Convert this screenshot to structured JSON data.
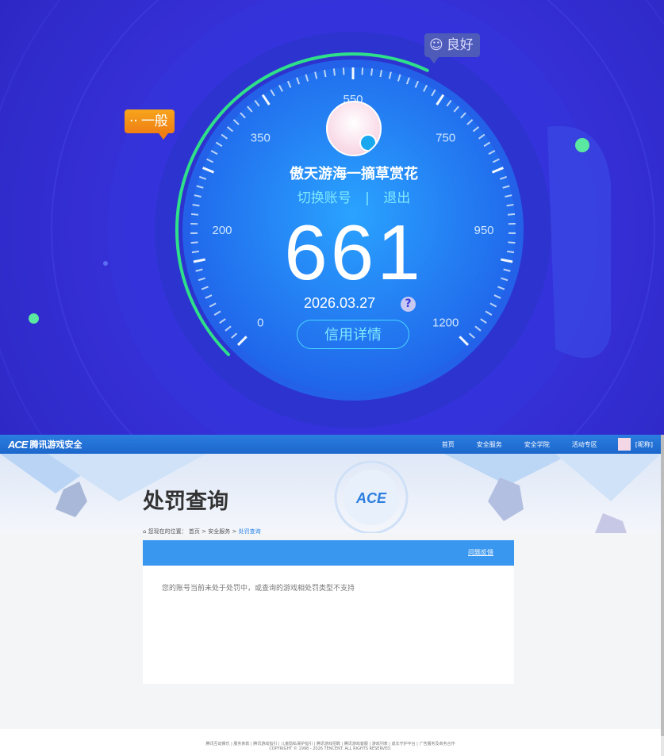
{
  "credit": {
    "bubble_normal": "一般",
    "bubble_good": "良好",
    "nickname": "傲天游海一摘草赏花",
    "switch_label": "切换账号",
    "separator": "|",
    "logout_label": "退出",
    "score": "661",
    "date": "2026.03.27",
    "help_glyph": "?",
    "detail_label": "信用详情",
    "ticks": [
      {
        "label": "0",
        "value": 0
      },
      {
        "label": "200",
        "value": 200
      },
      {
        "label": "350",
        "value": 350
      },
      {
        "label": "550",
        "value": 550
      },
      {
        "label": "750",
        "value": 750
      },
      {
        "label": "950",
        "value": 950
      },
      {
        "label": "1200",
        "value": 1200
      }
    ],
    "gauge_level": 661,
    "gauge_max": 1200,
    "colors": {
      "accent": "#49d6ff",
      "track": "#2fe08a",
      "orange": "#f29218"
    }
  },
  "site": {
    "logo_mark": "ACE",
    "logo_text": "腾讯游戏安全",
    "nav": [
      "首页",
      "安全服务",
      "安全学院",
      "活动专区"
    ],
    "user_name": "[昵称]",
    "page_title": "处罚查询",
    "breadcrumb": {
      "prefix": "您现在的位置：",
      "home": "首页",
      "sep": ">",
      "section": "安全服务",
      "current": "处罚查询"
    },
    "feedback_link": "问题反馈",
    "message": "您的账号当前未处于处罚中，或查询的游戏相处罚类型不支持",
    "footer_links": "腾讯互动娱乐 | 服务条款 | 腾讯游戏指引 | 儿童隐私保护指引 | 腾讯游戏招聘 | 腾讯游戏客服 | 游戏列表 | 成长守护平台 | 广告服务及商务合作",
    "footer_copy": "COPYRIGHT © 1998 - 2026 TENCENT. ALL RIGHTS RESERVED."
  }
}
